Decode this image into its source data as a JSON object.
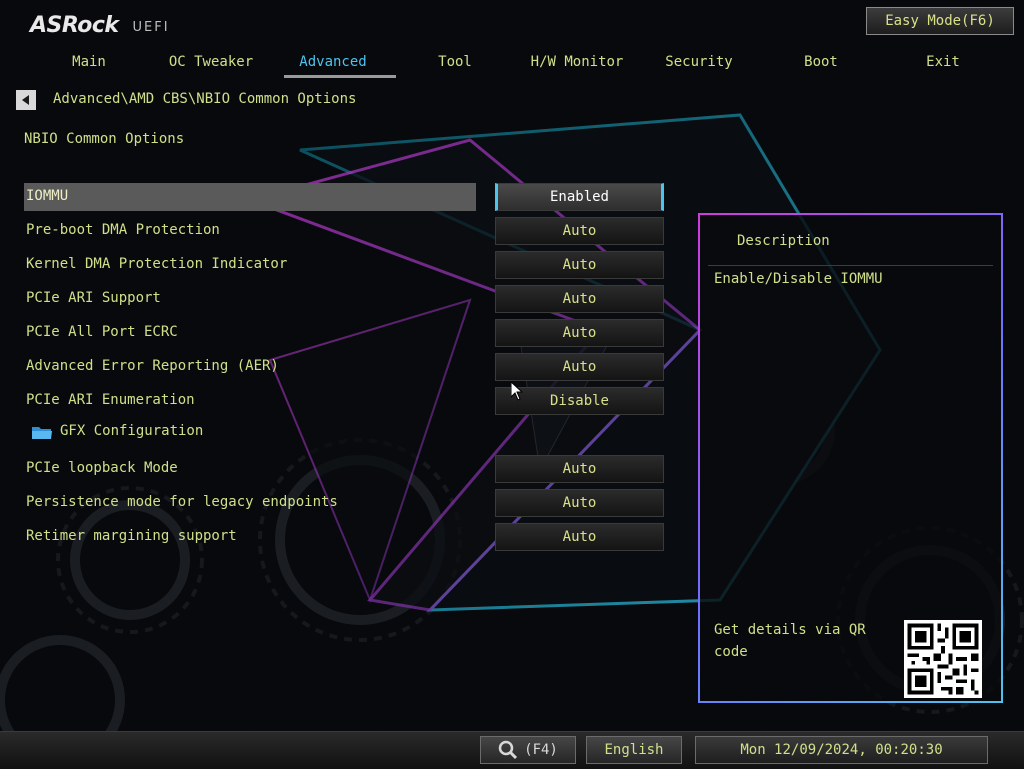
{
  "app": {
    "brand": "ASRock",
    "sub": "UEFI",
    "easy_mode": "Easy Mode(F6)"
  },
  "tabs": [
    {
      "label": "Main"
    },
    {
      "label": "OC Tweaker"
    },
    {
      "label": "Advanced",
      "active": true
    },
    {
      "label": "Tool"
    },
    {
      "label": "H/W Monitor"
    },
    {
      "label": "Security"
    },
    {
      "label": "Boot"
    },
    {
      "label": "Exit"
    }
  ],
  "breadcrumb": "Advanced\\AMD CBS\\NBIO Common Options",
  "page_title": "NBIO Common Options",
  "settings": [
    {
      "label": "IOMMU",
      "value": "Enabled",
      "selected": true
    },
    {
      "label": "Pre-boot DMA Protection",
      "value": "Auto"
    },
    {
      "label": "Kernel DMA Protection Indicator",
      "value": "Auto"
    },
    {
      "label": "PCIe ARI Support",
      "value": "Auto"
    },
    {
      "label": "PCIe All Port ECRC",
      "value": "Auto"
    },
    {
      "label": "Advanced Error Reporting (AER)",
      "value": "Auto"
    },
    {
      "label": "PCIe ARI Enumeration",
      "value": "Disable"
    },
    {
      "label": "GFX Configuration",
      "submenu": true
    },
    {
      "label": "PCIe loopback Mode",
      "value": "Auto"
    },
    {
      "label": "Persistence mode for legacy endpoints",
      "value": "Auto"
    },
    {
      "label": "Retimer margining support",
      "value": "Auto"
    }
  ],
  "description": {
    "heading": "Description",
    "text": "Enable/Disable IOMMU",
    "qr_text": "Get details via QR code"
  },
  "footer": {
    "search_key": "(F4)",
    "language": "English",
    "datetime": "Mon 12/09/2024, 00:20:30"
  },
  "colors": {
    "label_text": "#cfe08a",
    "accent_blue": "#4ec3ee",
    "accent_magenta": "#d23adc",
    "selection_bar": "#5a5a5a"
  },
  "icons": {
    "back": "triangle-left-icon",
    "folder": "folder-icon",
    "search": "magnifier-icon",
    "cursor": "mouse-pointer-icon"
  }
}
